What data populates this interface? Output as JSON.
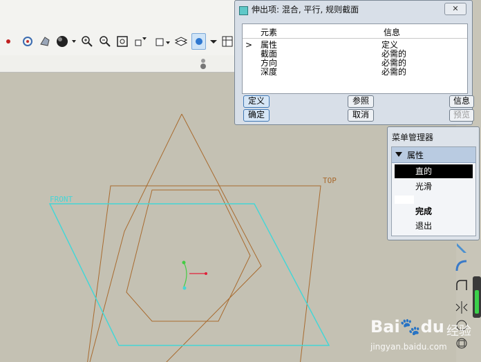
{
  "dialog": {
    "title": "伸出项: 混合, 平行, 规则截面",
    "close_label": "✕",
    "table": {
      "col_element": "元素",
      "col_info": "信息",
      "rows": [
        {
          "marker": ">",
          "element": "属性",
          "info": "定义"
        },
        {
          "marker": "",
          "element": "截面",
          "info": "必需的"
        },
        {
          "marker": "",
          "element": "方向",
          "info": "必需的"
        },
        {
          "marker": "",
          "element": "深度",
          "info": "必需的"
        }
      ]
    },
    "buttons": {
      "define": "定义",
      "refer": "参照",
      "info": "信息",
      "ok": "确定",
      "cancel": "取消",
      "preview": "预览"
    }
  },
  "menu_manager": {
    "title": "菜单管理器",
    "section": "属性",
    "items": [
      {
        "label": "直的",
        "selected": true
      },
      {
        "label": "光滑",
        "selected": false
      },
      {
        "label": "",
        "selected": false
      },
      {
        "label": "完成",
        "selected": false,
        "bold": true
      },
      {
        "label": "退出",
        "selected": false
      }
    ]
  },
  "graphics": {
    "datum_front": "FRONT",
    "datum_top": "TOP"
  },
  "watermark": {
    "brand": "Bai",
    "brand2": "du",
    "service": "经验",
    "url": "jingyan.baidu.com"
  },
  "colors": {
    "cyan": "#45d6d6",
    "brown": "#a86a2e",
    "red": "#e0203a",
    "green": "#44cc44"
  }
}
